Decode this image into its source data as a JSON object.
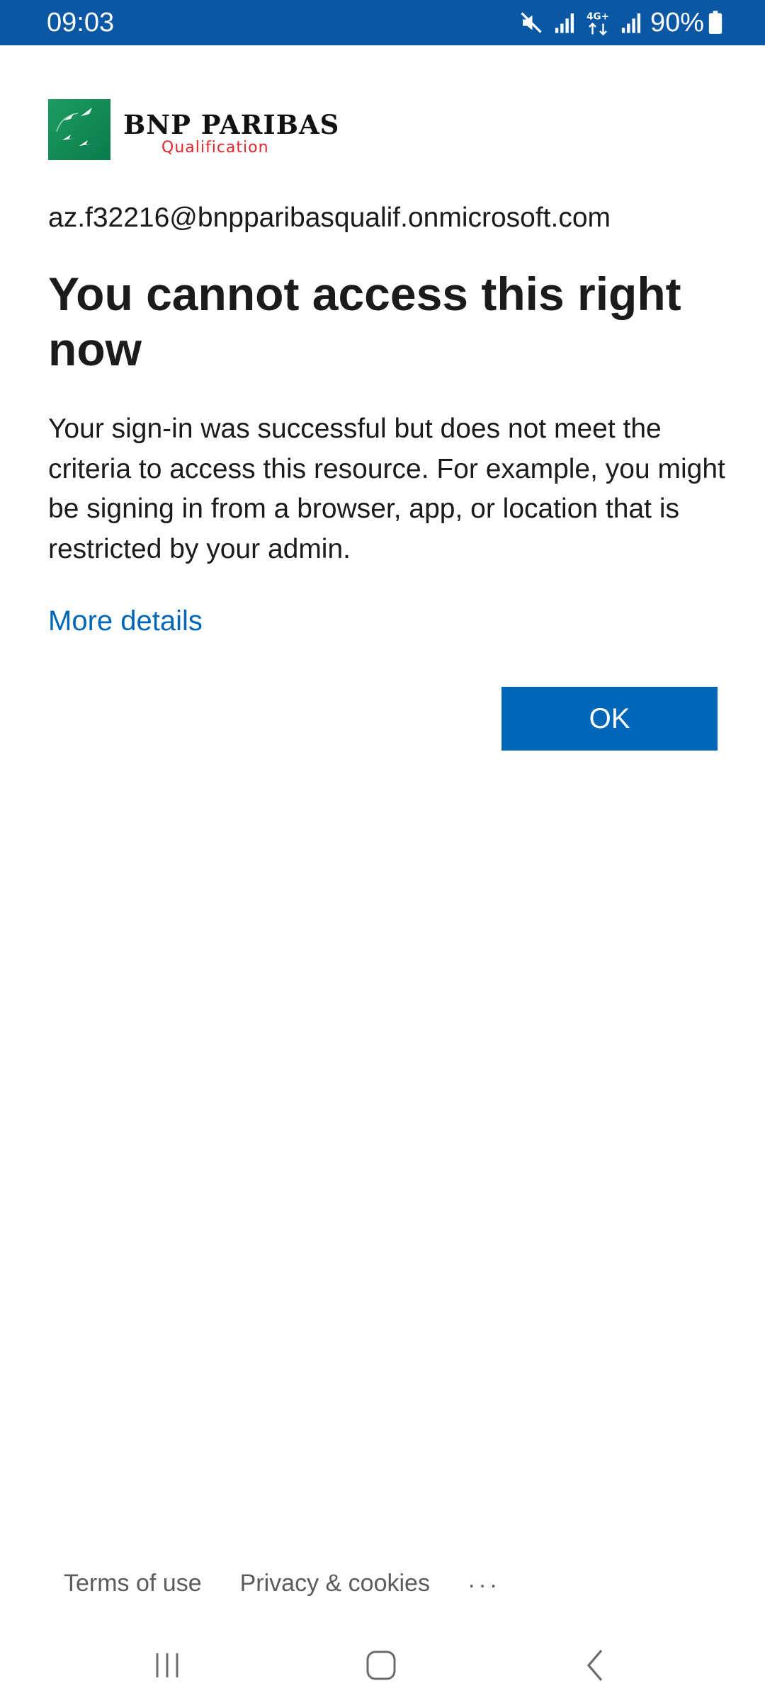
{
  "status_bar": {
    "time": "09:03",
    "battery": "90%",
    "network_label": "4G+",
    "icons": [
      "mute-icon",
      "signal-icon",
      "4g-data-icon",
      "signal-icon",
      "battery-icon"
    ]
  },
  "logo": {
    "name": "BNP PARIBAS",
    "subtitle": "Qualification"
  },
  "account": "az.f32216@bnpparibasqualif.onmicrosoft.com",
  "title": "You cannot access this right now",
  "description": "Your sign-in was successful but does not meet the criteria to access this resource. For example, you might be signing in from a browser, app, or location that is restricted by your admin.",
  "more_details_link": "More details",
  "ok_button": "OK",
  "footer": {
    "terms": "Terms of use",
    "privacy": "Privacy & cookies",
    "more": "..."
  },
  "nav_bar": {
    "icons": [
      "recent-apps-icon",
      "home-icon",
      "back-icon"
    ]
  },
  "colors": {
    "status_bar": "#0a57a4",
    "accent": "#0067b8",
    "logo_green": "#0a7a4a",
    "logo_red": "#e0262a"
  }
}
